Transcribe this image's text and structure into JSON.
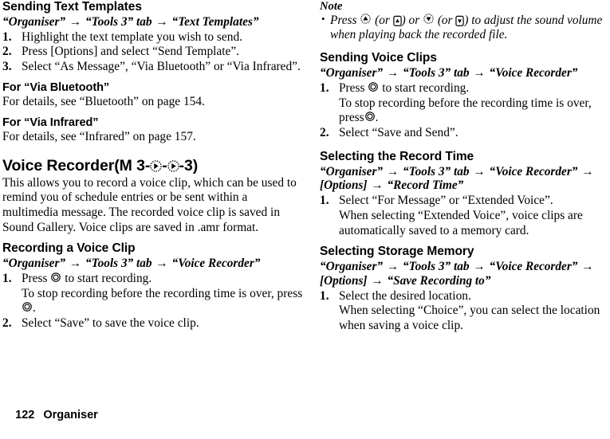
{
  "document": {
    "footer": {
      "page_number": "122",
      "section": "Organiser"
    }
  },
  "left_column": {
    "section_sending_text_templates": {
      "heading": "Sending Text Templates",
      "path": {
        "part1": "“Organiser”",
        "arrow1": "→",
        "part2": "“Tools 3” tab",
        "arrow2": "→",
        "part3": "“Text Templates”"
      },
      "steps": [
        {
          "num": "1.",
          "text": "Highlight the text template you wish to send."
        },
        {
          "num": "2.",
          "text": "Press [Options] and select “Send Template”."
        },
        {
          "num": "3.",
          "text": "Select “As Message”, “Via Bluetooth” or “Via Infrared”."
        }
      ]
    },
    "subsection_via_bluetooth": {
      "heading": "For “Via Bluetooth”",
      "text": "For details, see “Bluetooth” on page 154."
    },
    "subsection_via_infrared": {
      "heading": "For “Via Infrared”",
      "text": "For details, see “Infrared” on page 157."
    },
    "section_voice_recorder": {
      "heading_main": "Voice Recorder",
      "heading_code_open": "(M 3-",
      "heading_code_sep": "-",
      "heading_code_close": "-3)",
      "icon_nav_right": "navigation-right-key-icon",
      "intro": "This allows you to record a voice clip, which can be used to remind you of schedule entries or be sent within a multimedia message. The recorded voice clip is saved in Sound Gallery. Voice clips are saved in .amr format."
    },
    "subsection_recording": {
      "heading": "Recording a Voice Clip",
      "path": {
        "part1": "“Organiser”",
        "arrow1": "→",
        "part2": "“Tools 3” tab",
        "arrow2": "→",
        "part3": "“Voice Recorder”"
      },
      "step1": {
        "num": "1.",
        "text_before": "Press",
        "icon": "center-key-icon",
        "text_after": "to start recording.",
        "sub_before": "To stop recording before the recording time is over, press",
        "sub_icon": "center-key-icon",
        "sub_after": "."
      },
      "step2": {
        "num": "2.",
        "text": "Select “Save” to save the voice clip."
      }
    }
  },
  "right_column": {
    "note": {
      "title": "Note",
      "bullet": "•",
      "text_1": "Press",
      "icon_up": "navigation-up-key-icon",
      "text_2": "(or",
      "icon_side_up": "side-up-key-icon",
      "text_3": ") or",
      "icon_down": "navigation-down-key-icon",
      "text_4": "(or",
      "icon_side_down": "side-down-key-icon",
      "text_5": ") to adjust the sound volume when playing back the recorded file."
    },
    "section_sending_voice_clips": {
      "heading": "Sending Voice Clips",
      "path": {
        "part1": "“Organiser”",
        "arrow1": "→",
        "part2": "“Tools 3” tab",
        "arrow2": "→",
        "part3": "“Voice Recorder”"
      },
      "step1": {
        "num": "1.",
        "text_before": "Press",
        "icon": "center-key-icon",
        "text_after": "to start recording.",
        "sub_before": "To stop recording before the recording time is over, press",
        "sub_icon": "center-key-icon",
        "sub_after": "."
      },
      "step2": {
        "num": "2.",
        "text": "Select “Save and Send”."
      }
    },
    "section_record_time": {
      "heading": "Selecting the Record Time",
      "path": {
        "part1": "“Organiser”",
        "arrow1": "→",
        "part2": "“Tools 3” tab",
        "arrow2": "→",
        "part3": "“Voice Recorder”",
        "arrow3": "→",
        "part4": "[Options]",
        "arrow4": "→",
        "part5": "“Record Time”"
      },
      "step1": {
        "num": "1.",
        "text": "Select “For Message” or “Extended Voice”.",
        "sub": "When selecting “Extended Voice”, voice clips are automatically saved to a memory card."
      }
    },
    "section_storage_memory": {
      "heading": "Selecting Storage Memory",
      "path": {
        "part1": "“Organiser”",
        "arrow1": "→",
        "part2": "“Tools 3” tab",
        "arrow2": "→",
        "part3": "“Voice Recorder”",
        "arrow3": "→",
        "part4": "[Options]",
        "arrow4": "→",
        "part5": "“Save Recording to”"
      },
      "step1": {
        "num": "1.",
        "text": "Select the desired location.",
        "sub": "When selecting “Choice”, you can select the location when saving a voice clip."
      }
    }
  }
}
